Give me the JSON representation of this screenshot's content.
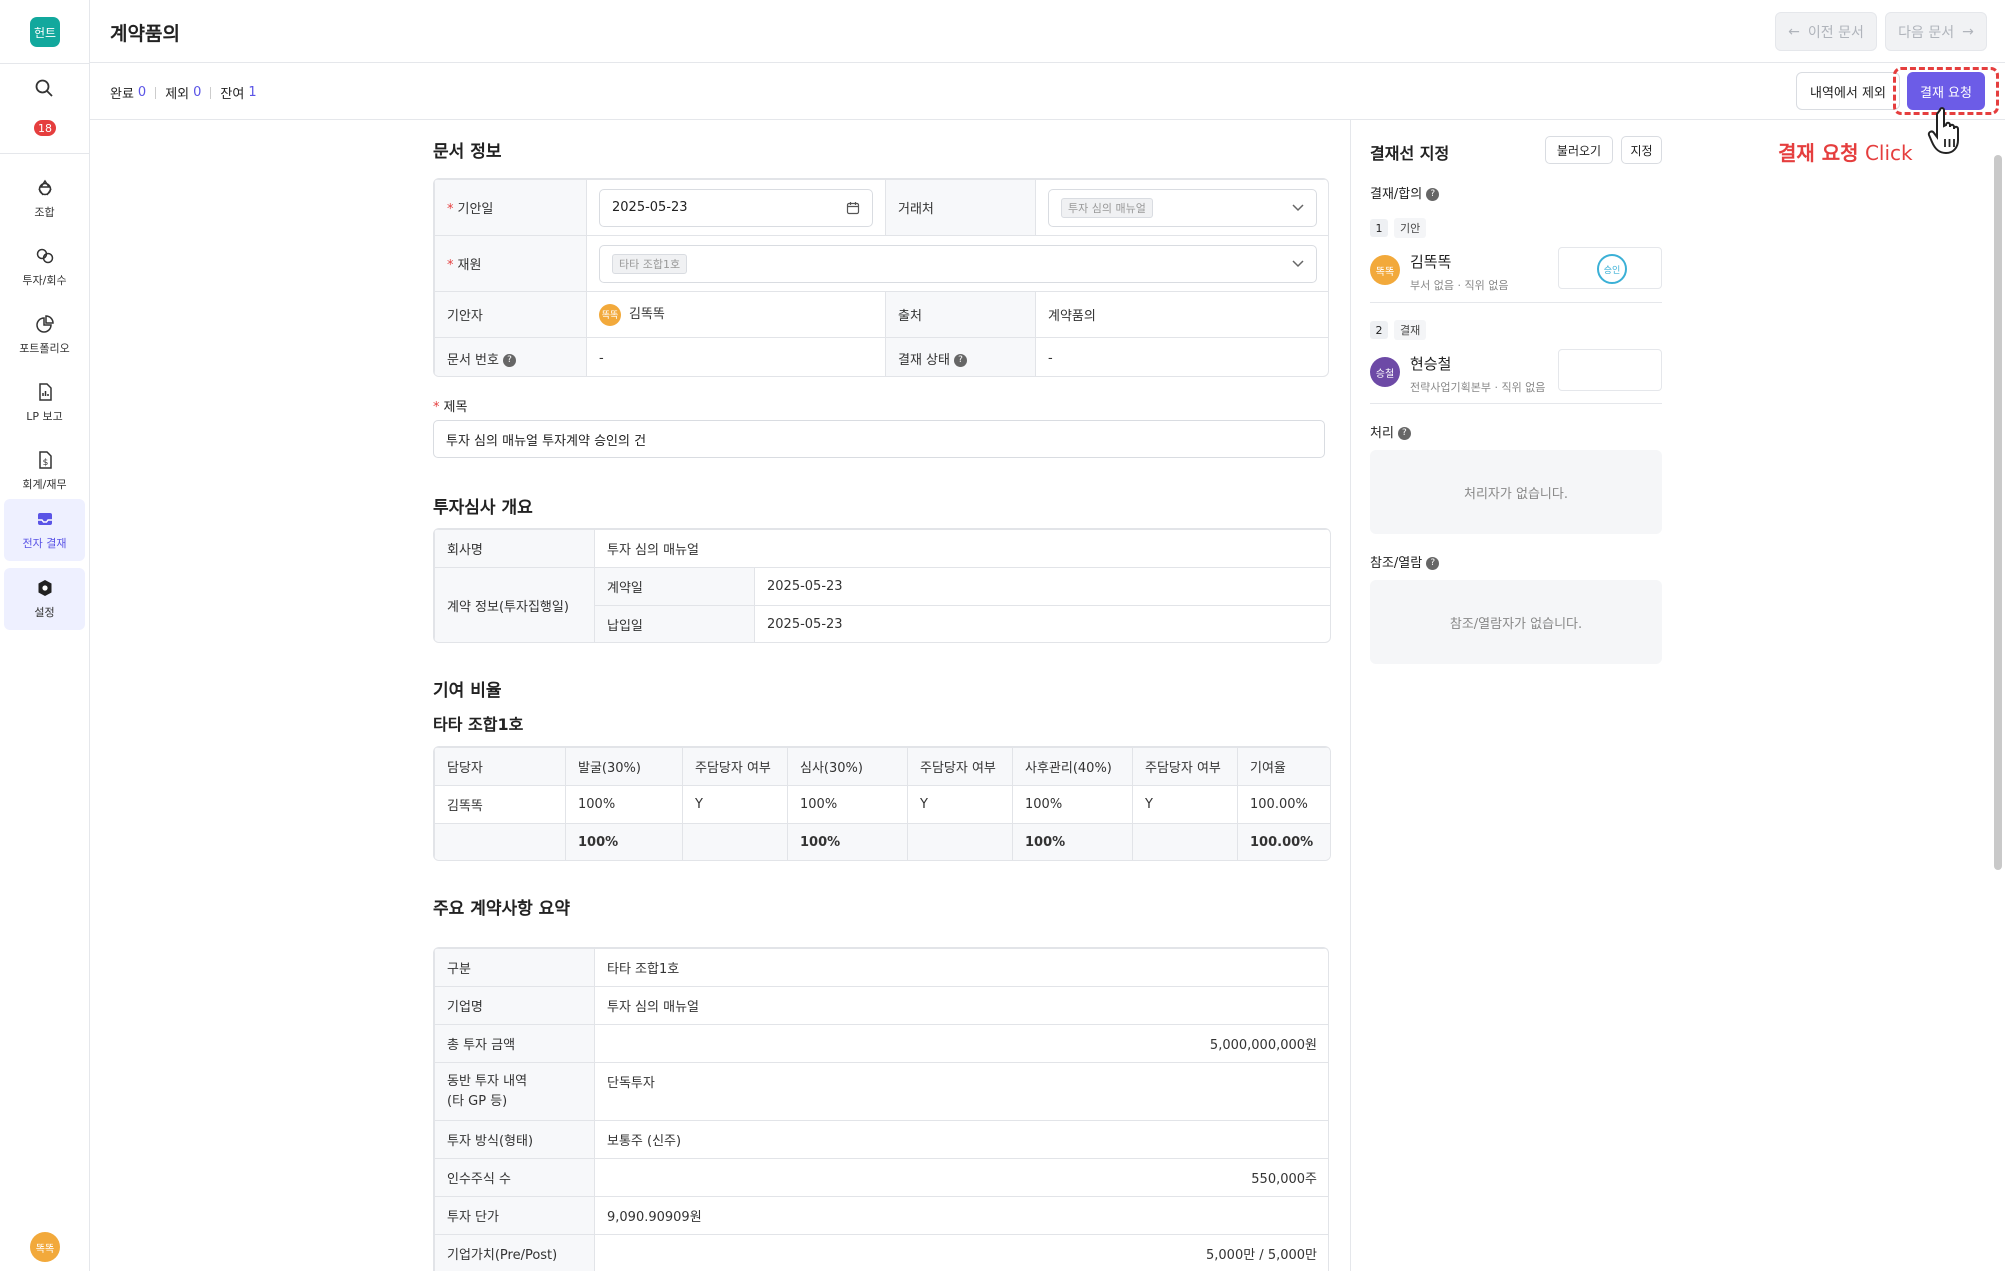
{
  "sidebar": {
    "logo": "헌트",
    "badge": "18",
    "items": [
      {
        "label": "조합",
        "icon": "recycle-icon"
      },
      {
        "label": "투자/회수",
        "icon": "exchange-icon"
      },
      {
        "label": "포트폴리오",
        "icon": "pie-chart-icon"
      },
      {
        "label": "LP 보고",
        "icon": "report-icon"
      },
      {
        "label": "회계/재무",
        "icon": "accounting-icon"
      },
      {
        "label": "전자 결재",
        "icon": "inbox-icon"
      },
      {
        "label": "설정",
        "icon": "gear-icon"
      }
    ],
    "user": "똑똑"
  },
  "header": {
    "title": "계약품의",
    "prev": "이전 문서",
    "next": "다음 문서"
  },
  "subbar": {
    "done_label": "완료",
    "done_count": "0",
    "excluded_label": "제외",
    "excluded_count": "0",
    "remaining_label": "잔여",
    "remaining_count": "1",
    "exclude_button": "내역에서 제외",
    "request_button": "결재 요청",
    "click_hint_bold": "결재 요청",
    "click_hint": "Click"
  },
  "doc_info": {
    "section_title": "문서 정보",
    "date_label": "기안일",
    "date_value": "2025-05-23",
    "client_label": "거래처",
    "client_value": "투자 심의 매뉴얼",
    "fund_label": "재원",
    "fund_value": "타타 조합1호",
    "drafter_label": "기안자",
    "drafter_avatar": "똑똑",
    "drafter_value": "김똑똑",
    "source_label": "출처",
    "source_value": "계약품의",
    "docno_label": "문서 번호",
    "docno_value": "-",
    "status_label": "결재 상태",
    "status_value": "-",
    "subject_label": "제목",
    "subject_value": "투자 심의 매뉴얼 투자계약 승인의 건"
  },
  "overview": {
    "section_title": "투자심사 개요",
    "company_label": "회사명",
    "company_value": "투자 심의 매뉴얼",
    "contract_label": "계약 정보(투자집행일)",
    "contract_date_label": "계약일",
    "contract_date_value": "2025-05-23",
    "pay_date_label": "납입일",
    "pay_date_value": "2025-05-23"
  },
  "contribution": {
    "section_title": "기여 비율",
    "fund_title": "타타 조합1호",
    "headers": [
      "담당자",
      "발굴(30%)",
      "주담당자 여부",
      "심사(30%)",
      "주담당자 여부",
      "사후관리(40%)",
      "주담당자 여부",
      "기여율"
    ],
    "row": [
      "김똑똑",
      "100%",
      "Y",
      "100%",
      "Y",
      "100%",
      "Y",
      "100.00%"
    ],
    "total": [
      "",
      "100%",
      "",
      "100%",
      "",
      "100%",
      "",
      "100.00%"
    ]
  },
  "summary": {
    "section_title": "주요 계약사항 요약",
    "rows": [
      {
        "label": "구분",
        "value": "타타 조합1호"
      },
      {
        "label": "기업명",
        "value": "투자 심의 매뉴얼"
      },
      {
        "label": "총 투자 금액",
        "value": "5,000,000,000원"
      },
      {
        "label": "동반 투자 내역",
        "label2": "(타 GP 등)",
        "value": "단독투자"
      },
      {
        "label": "투자 방식(형태)",
        "value": "보통주 (신주)"
      },
      {
        "label": "인수주식 수",
        "value": "550,000주"
      },
      {
        "label": "투자 단가",
        "value": "9,090.90909원"
      },
      {
        "label": "기업가치(Pre/Post)",
        "value": "5,000만 / 5,000만"
      }
    ]
  },
  "approval": {
    "title": "결재선 지정",
    "load_button": "불러오기",
    "assign_button": "지정",
    "line_label": "결재/합의",
    "steps": [
      {
        "num": "1",
        "tag": "기안",
        "avatar": "똑똑",
        "name": "김똑똑",
        "info": "부서 없음 · 직위 없음",
        "stamp": "승인"
      },
      {
        "num": "2",
        "tag": "결재",
        "avatar": "승철",
        "name": "현승철",
        "info": "전략사업기획본부 · 직위 없음"
      }
    ],
    "process_label": "처리",
    "process_empty": "처리자가 없습니다.",
    "ref_label": "참조/열람",
    "ref_empty": "참조/열람자가 없습니다."
  }
}
